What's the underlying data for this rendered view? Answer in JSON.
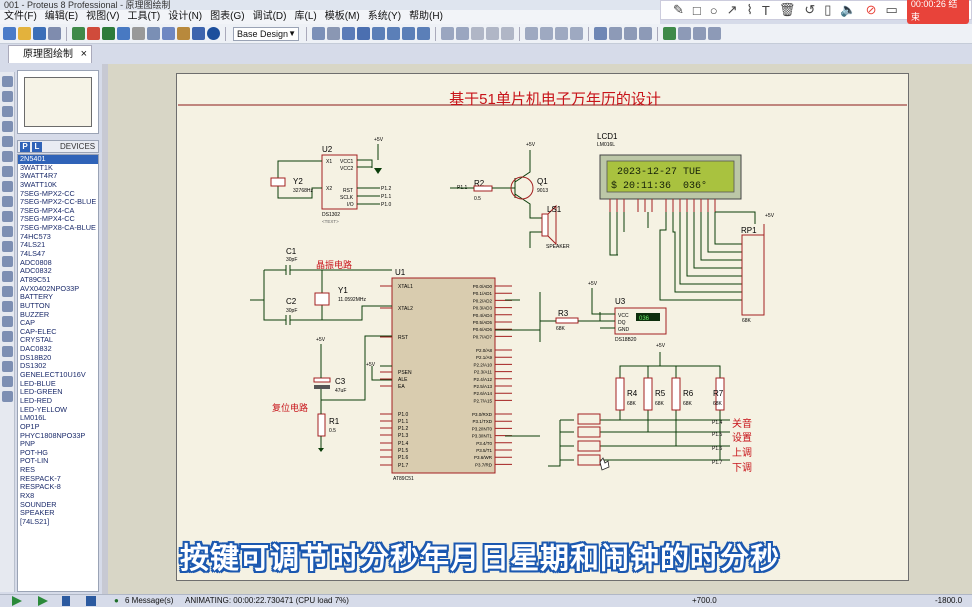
{
  "window": {
    "title": "001 - Proteus 8 Professional - 原理图绘制"
  },
  "menu": [
    "文件(F)",
    "编辑(E)",
    "视图(V)",
    "工具(T)",
    "设计(N)",
    "图表(G)",
    "调试(D)",
    "库(L)",
    "模板(M)",
    "系统(Y)",
    "帮助(H)"
  ],
  "toolbar": {
    "layer_select": "Base Design"
  },
  "recorder": {
    "time": "00:00:26 结束"
  },
  "tab": {
    "label": "原理图绘制"
  },
  "devices_panel": {
    "p_button": "P",
    "l_button": "L",
    "header": "DEVICES",
    "items": [
      "2N5401",
      "3WATT1K",
      "3WATT4R7",
      "3WATT10K",
      "7SEG-MPX2-CC",
      "7SEG-MPX2-CC-BLUE",
      "7SEG-MPX4-CA",
      "7SEG-MPX4-CC",
      "7SEG-MPX8-CA-BLUE",
      "74HC573",
      "74LS21",
      "74LS47",
      "ADC0808",
      "ADC0832",
      "AT89C51",
      "AVX0402NPO33P",
      "BATTERY",
      "BUTTON",
      "BUZZER",
      "CAP",
      "CAP-ELEC",
      "CRYSTAL",
      "DAC0832",
      "DS18B20",
      "DS1302",
      "GENELECT10U16V",
      "LED-BLUE",
      "LED-GREEN",
      "LED-RED",
      "LED-YELLOW",
      "LM016L",
      "OP1P",
      "PHYC1808NPO33P",
      "PNP",
      "POT-HG",
      "POT-LIN",
      "RES",
      "RESPACK-7",
      "RESPACK-8",
      "RX8",
      "SOUNDER",
      "SPEAKER",
      "[74LS21]"
    ],
    "selected_index": 0
  },
  "schematic": {
    "title": "基于51单片机电子万年历的设计",
    "lcd": {
      "ref": "LCD1",
      "part": "LM016L",
      "line1": "2023-12-27 TUE",
      "line2": "$ 20:11:36  036°"
    },
    "labels": {
      "crystal_circuit": "晶振电路",
      "reset_circuit": "复位电路",
      "u1": "U1",
      "u1_part": "AT89C51",
      "u2": "U2",
      "u2_part": "DS1302",
      "u3": "U3",
      "u3_part": "DS18B20",
      "y1": "Y1",
      "y1_freq": "11.0592MHz",
      "y2": "Y2",
      "y2_freq": "32768Hz",
      "c1": "C1",
      "c1_val": "30pF",
      "c2": "C2",
      "c2_val": "30pF",
      "c3": "C3",
      "c3_val": "47uF",
      "r1": "R1",
      "r1_val": "0.5",
      "r2": "R2",
      "r2_val": "0.5",
      "r3": "R3",
      "r3_val": "68K",
      "r4": "R4",
      "r5": "R5",
      "r6": "R6",
      "r7": "R7",
      "rk_val": "68K",
      "q1": "Q1",
      "q1_part": "9013",
      "ls1": "LS1",
      "ls1_part": "SPEAKER",
      "rp1": "RP1",
      "rp1_val": "68K",
      "vcc": "+5V",
      "text_tag": "<TEXT>",
      "u3_reading": "036",
      "u2_pins_left": [
        "X1",
        "X2"
      ],
      "u2_pins_right": [
        "VCC1",
        "VCC2",
        "RST",
        "SCLK",
        "I/O"
      ],
      "u2_ports": [
        "P1.2",
        "P1.1",
        "P1.0"
      ],
      "u1_pins_left": [
        "XTAL1",
        "XTAL2",
        "RST",
        "PSEN",
        "ALE",
        "EA",
        "P1.0",
        "P1.1",
        "P1.2",
        "P1.3",
        "P1.4",
        "P1.5",
        "P1.6",
        "P1.7"
      ],
      "u1_pins_right": [
        "P0.0/AD0",
        "P0.1/AD1",
        "P0.2/AD2",
        "P0.3/AD3",
        "P0.4/AD4",
        "P0.5/AD5",
        "P0.6/AD6",
        "P0.7/AD7",
        "P2.0/A8",
        "P2.1/A9",
        "P2.2/A10",
        "P2.3/A11",
        "P2.4/A12",
        "P2.5/A13",
        "P2.6/A14",
        "P2.7/A15",
        "P3.0/RXD",
        "P3.1/TXD",
        "P3.2/INT0",
        "P3.3/INT1",
        "P3.4/T0",
        "P3.5/T1",
        "P3.6/WR",
        "P3.7/RD"
      ],
      "u3_pins": [
        "VCC",
        "DQ",
        "GND"
      ],
      "buttons": [
        "关音",
        "设置",
        "上调",
        "下调"
      ],
      "button_ports": [
        "P1.4",
        "P1.5",
        "P1.6",
        "P1.7"
      ]
    }
  },
  "caption": "按键可调节时分秒年月日星期和闹钟的时分秒",
  "status": {
    "messages": "6 Message(s)",
    "animating": "ANIMATING: 00:00:22.730471 (CPU load 7%)",
    "coord_x": "+700.0",
    "coord_y": "-1800.0"
  }
}
